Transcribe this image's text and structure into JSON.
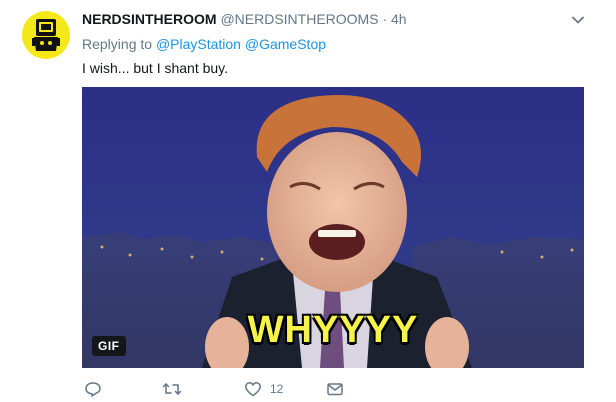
{
  "tweet": {
    "display_name": "NERDSINTHEROOM",
    "handle": "@NERDSINTHEROOMS",
    "separator": "·",
    "time": "4h",
    "replying_prefix": "Replying to",
    "mentions": [
      "@PlayStation",
      "@GameStop"
    ],
    "text": "I wish... but I shant buy.",
    "media": {
      "badge": "GIF",
      "caption": "WHYYYY"
    },
    "actions": {
      "reply_icon": "reply-icon",
      "retweet_icon": "retweet-icon",
      "like_icon": "heart-icon",
      "like_count": "12",
      "dm_icon": "envelope-icon"
    }
  },
  "colors": {
    "link": "#1b95e0",
    "muted": "#657786",
    "avatar_bg": "#f4e71a",
    "gif_caption": "#f6f34a"
  }
}
